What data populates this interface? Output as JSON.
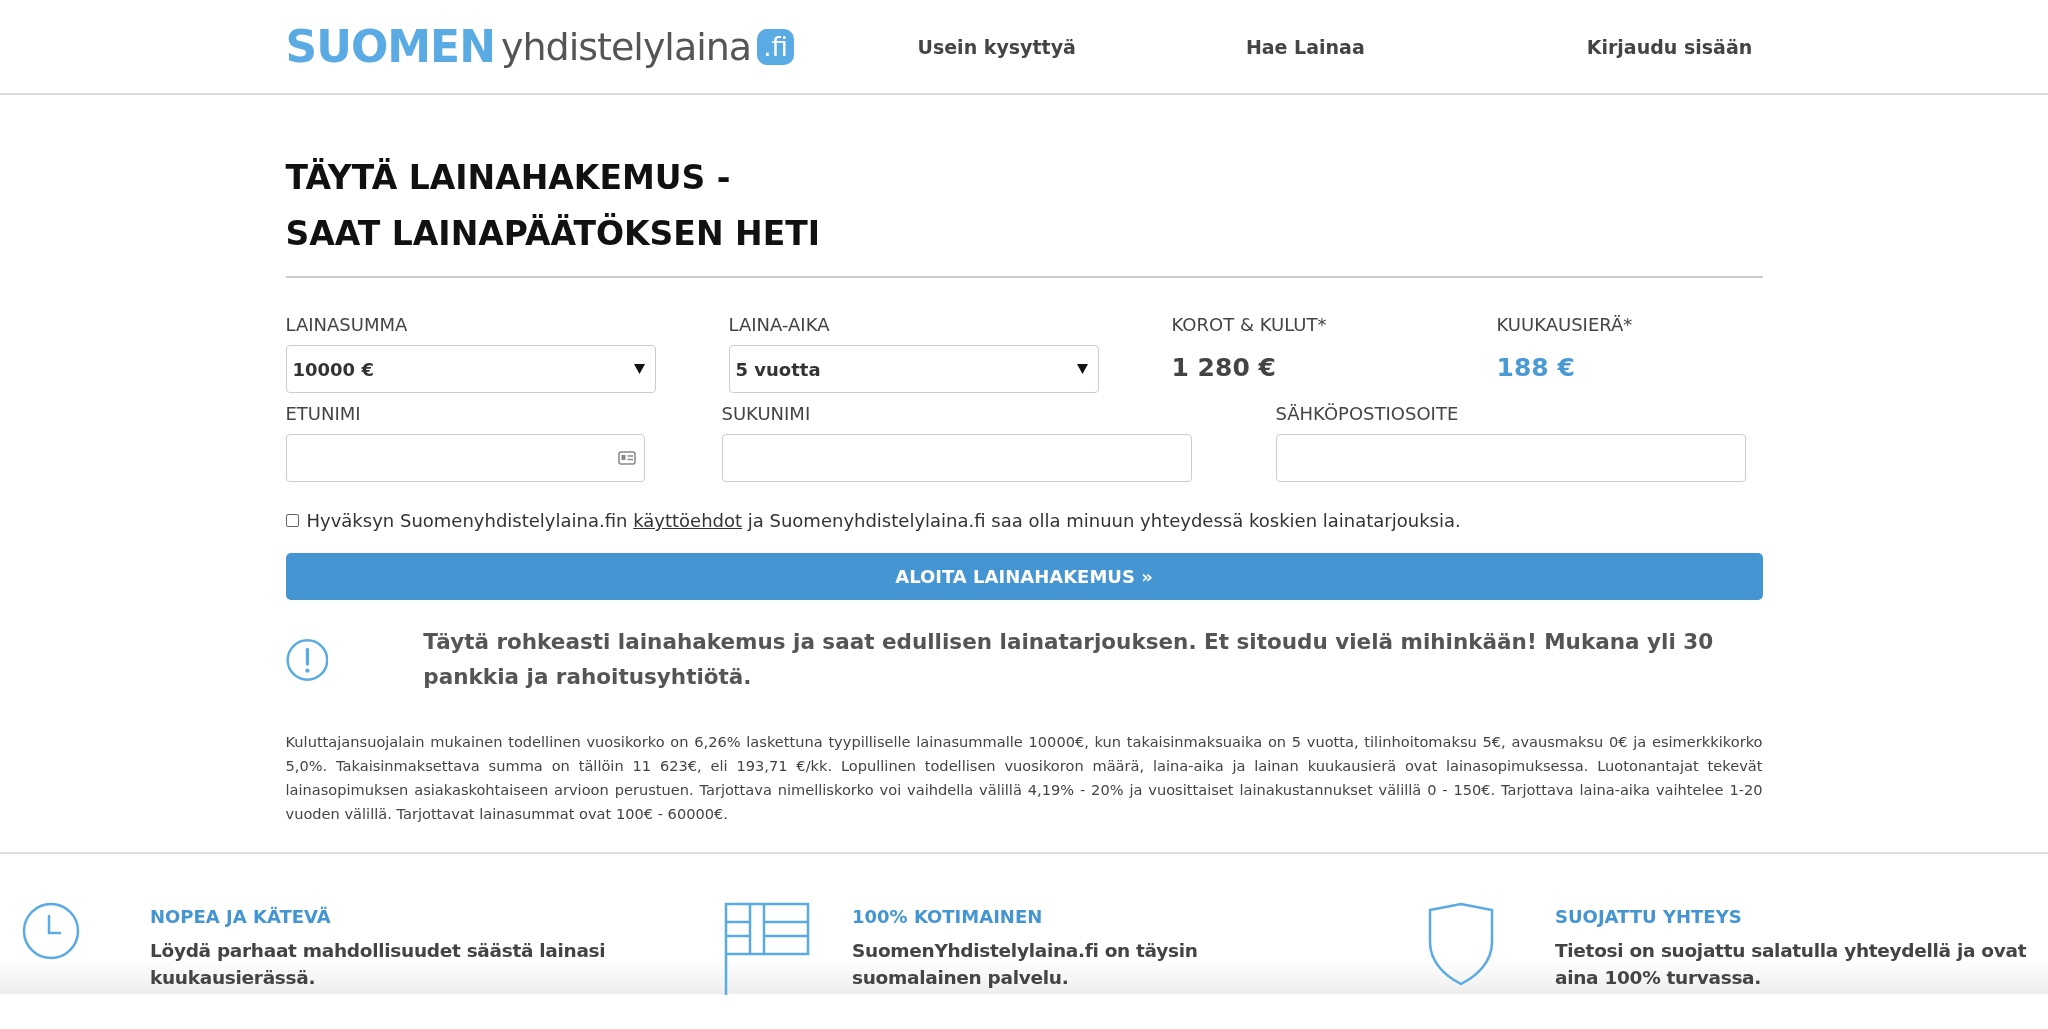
{
  "header": {
    "logo": {
      "brand": "SUOMEN",
      "name": "yhdistelylaina",
      "tld": ".fi"
    },
    "nav": [
      {
        "label": "Usein kysyttyä"
      },
      {
        "label": "Hae Lainaa"
      },
      {
        "label": "Kirjaudu sisään"
      }
    ]
  },
  "form": {
    "title_lines": [
      "TÄYTÄ LAINAHAKEMUS -",
      "SAAT LAINAPÄÄTÖKSEN HETI"
    ],
    "loan": [
      {
        "kind": "select",
        "label": "LAINASUMMA",
        "value": "10000 €"
      },
      {
        "kind": "select",
        "label": "LAINA-AIKA",
        "value": "5 vuotta"
      },
      {
        "kind": "figure",
        "label": "KOROT & KULUT*",
        "value": "1 280 €",
        "color": "#444444"
      },
      {
        "kind": "figure",
        "label": "KUUKAUSIERÄ*",
        "value": "188 €",
        "color": "#4a9ad6"
      }
    ],
    "fields": [
      {
        "label": "ETUNIMI",
        "contact_icon": true
      },
      {
        "label": "SUKUNIMI",
        "contact_icon": false
      },
      {
        "label": "SÄHKÖPOSTIOSOITE",
        "contact_icon": false
      }
    ],
    "consent": {
      "checked": false,
      "before": "Hyväksyn Suomenyhdistelylaina.fin",
      "link": "käyttöehdot",
      "after": "ja Suomenyhdistelylaina.fi saa olla minuun yhteydessä koskien lainatarjouksia."
    },
    "submit": "ALOITA LAINAHAKEMUS »",
    "notice": "Täytä rohkeasti lainahakemus ja saat edullisen lainatarjouksen. Et sitoudu vielä mihinkään! Mukana yli 30 pankkia ja rahoitusyhtiötä.",
    "disclaimer": "Kuluttajansuojalain mukainen todellinen vuosikorko on 6,26% laskettuna tyypilliselle lainasummalle 10000€, kun takaisinmaksuaika on 5 vuotta, tilinhoitomaksu 5€, avausmaksu 0€ ja esimerkkikorko 5,0%. Takaisinmaksettava summa on tällöin 11 623€, eli 193,71 €/kk. Lopullinen todellisen vuosikoron määrä, laina-aika ja lainan kuukausierä ovat lainasopimuksessa. Luotonantajat tekevät lainasopimuksen asiakaskohtaiseen arvioon perustuen. Tarjottava nimelliskorko voi vaihdella välillä 4,19% - 20% ja vuosittaiset lainakustannukset välillä 0 - 150€. Tarjottava laina-aika vaihtelee 1-20 vuoden välillä. Tarjottavat lainasummat ovat 100€ - 60000€."
  },
  "features": [
    {
      "kind": "clock",
      "title": "NOPEA JA KÄTEVÄ",
      "text": "Löydä parhaat mahdollisuudet säästä lainasi kuukausierässä."
    },
    {
      "kind": "flag",
      "title": "100% KOTIMAINEN",
      "text": "SuomenYhdistelylaina.fi on täysin suomalainen palvelu."
    },
    {
      "kind": "shield",
      "title": "SUOJATTU YHTEYS",
      "text": "Tietosi on suojattu salatulla yhteydellä ja ovat aina 100% turvassa."
    }
  ]
}
